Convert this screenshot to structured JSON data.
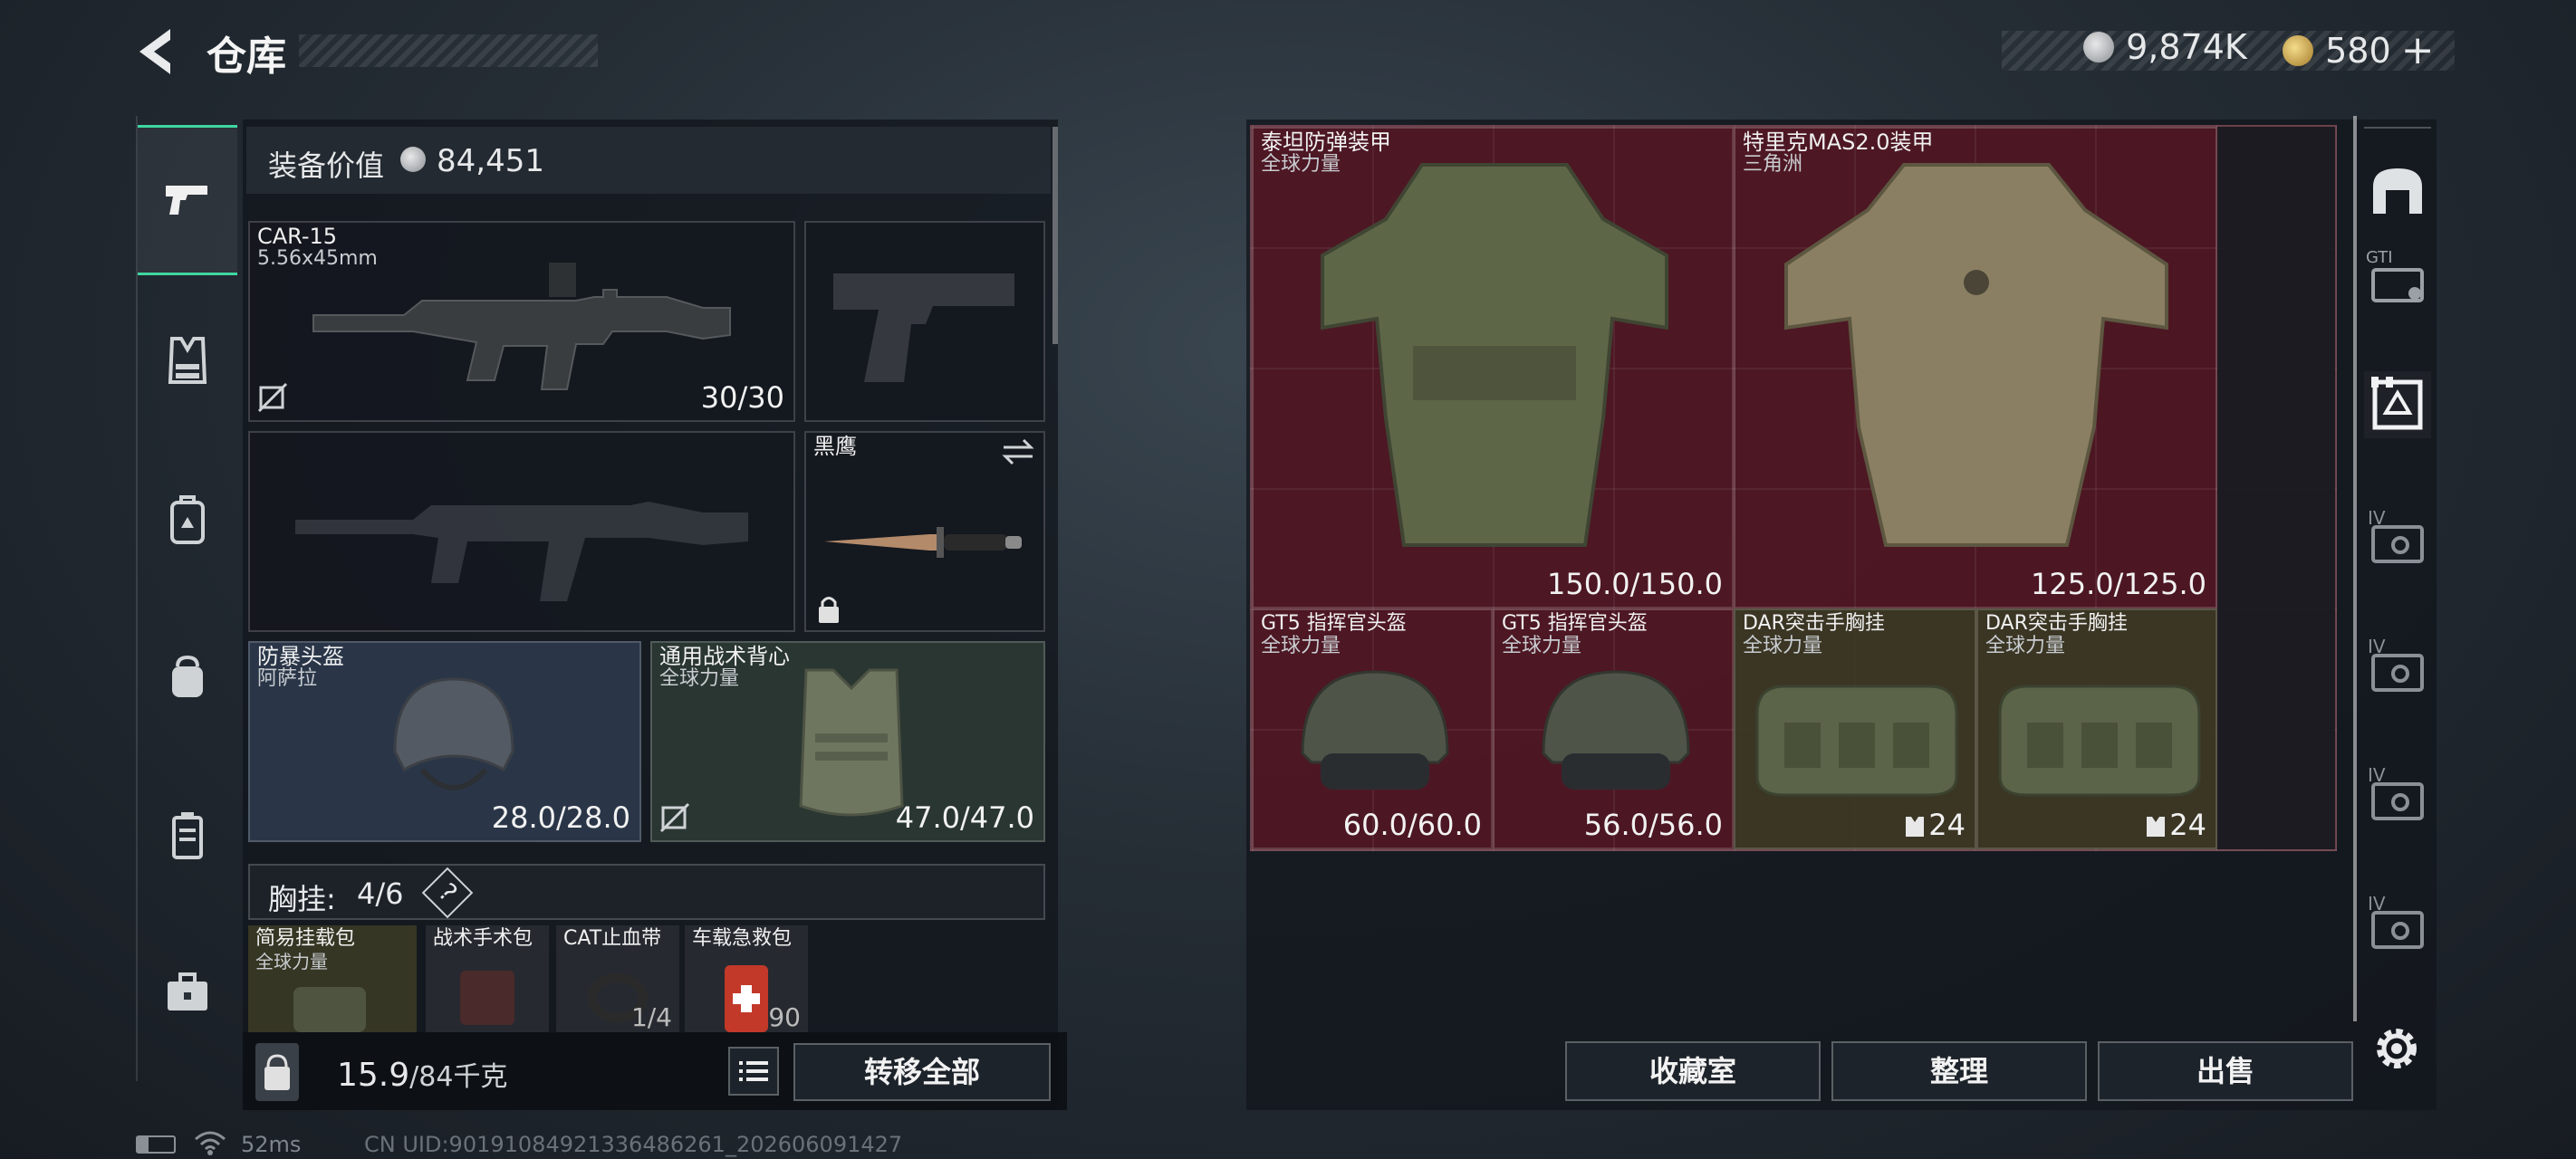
{
  "header": {
    "back_icon": "back-arrow-icon",
    "title": "仓库",
    "currency1_icon": "silver-coin-icon",
    "currency1_value": "9,874K",
    "currency2_icon": "gold-coin-icon",
    "currency2_value": "580",
    "currency2_add": "+"
  },
  "left_nav": {
    "items": [
      {
        "icon": "pistol-icon",
        "active": true
      },
      {
        "icon": "vest-icon"
      },
      {
        "icon": "backpack-icon"
      },
      {
        "icon": "pouch-icon"
      },
      {
        "icon": "case-icon"
      },
      {
        "icon": "toolbox-icon"
      }
    ]
  },
  "equipment": {
    "value_label": "装备价值",
    "value": "84,451",
    "primary_weapon": {
      "name": "CAR-15",
      "sub": "5.56x45mm",
      "value": "30/30"
    },
    "knife": {
      "name": "黑鹰"
    },
    "helmet": {
      "name": "防暴头盔",
      "sub": "阿萨拉",
      "value": "28.0/28.0"
    },
    "vest": {
      "name": "通用战术背心",
      "sub": "全球力量",
      "value": "47.0/47.0"
    },
    "chest_rig": {
      "label": "胸挂:",
      "count": "4/6",
      "help": "?"
    },
    "rig_items": [
      {
        "name": "简易挂载包",
        "sub": "全球力量"
      },
      {
        "name": "战术手术包",
        "sub": ""
      },
      {
        "name": "CAT止血带",
        "sub": "",
        "value": "1/4"
      },
      {
        "name": "车载急救包",
        "sub": "",
        "value": "90"
      }
    ]
  },
  "bottom_bar": {
    "weight": "15.9",
    "weight_max": "/84千克",
    "transfer_all": "转移全部"
  },
  "storage": {
    "items": [
      {
        "name": "泰坦防弹装甲",
        "sub": "全球力量",
        "value": "150.0/150.0"
      },
      {
        "name": "特里克MAS2.0装甲",
        "sub": "三角洲",
        "value": "125.0/125.0"
      },
      {
        "name": "GT5 指挥官头盔",
        "sub": "全球力量",
        "value": "60.0/60.0"
      },
      {
        "name": "GT5 指挥官头盔",
        "sub": "全球力量",
        "value": "56.0/56.0"
      },
      {
        "name": "DAR突击手胸挂",
        "sub": "全球力量",
        "value": "24"
      },
      {
        "name": "DAR突击手胸挂",
        "sub": "全球力量",
        "value": "24"
      }
    ]
  },
  "actions": {
    "collection": "收藏室",
    "sort": "整理",
    "sell": "出售"
  },
  "right_nav": {
    "items": [
      {
        "icon": "home-icon",
        "label": ""
      },
      {
        "icon": "case-tier-icon",
        "label": "GTI"
      },
      {
        "icon": "armor-filter-icon",
        "label": ""
      },
      {
        "icon": "tier-case-icon",
        "label": "IV"
      },
      {
        "icon": "tier-case-icon",
        "label": "IV"
      },
      {
        "icon": "tier-case-icon",
        "label": "IV"
      },
      {
        "icon": "tier-case-icon",
        "label": "IV"
      }
    ],
    "settings_icon": "gear-icon"
  },
  "status": {
    "ping": "52ms",
    "uid": "CN UID:90191084921336486261_202606091427"
  },
  "colors": {
    "storage_bg": "#5c1624",
    "rig_bg": "#3a3a25",
    "helmet_bg": "#2c3a4c",
    "vest_bg": "#2c3a34",
    "accent_green": "#3fd6a0"
  }
}
